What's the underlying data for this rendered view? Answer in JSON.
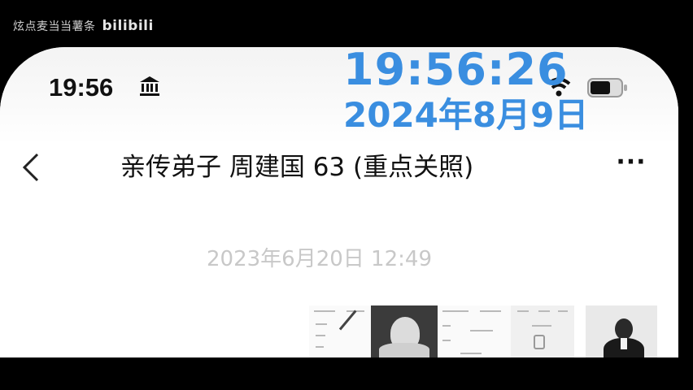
{
  "watermark": {
    "channel": "炫点麦当当薯条",
    "logo": "bilibili"
  },
  "status_bar": {
    "time": "19:56",
    "icons": [
      "bank-icon",
      "wifi-icon",
      "battery-icon"
    ]
  },
  "overlay": {
    "time": "19:56:26",
    "date": "2024年8月9日",
    "color": "#3a8ee0"
  },
  "nav": {
    "back_icon": "chevron-left-icon",
    "title": "亲传弟子 周建国 63 (重点关照)",
    "more_label": "···"
  },
  "chat": {
    "timestamp": "2023年6月20日 12:49"
  }
}
